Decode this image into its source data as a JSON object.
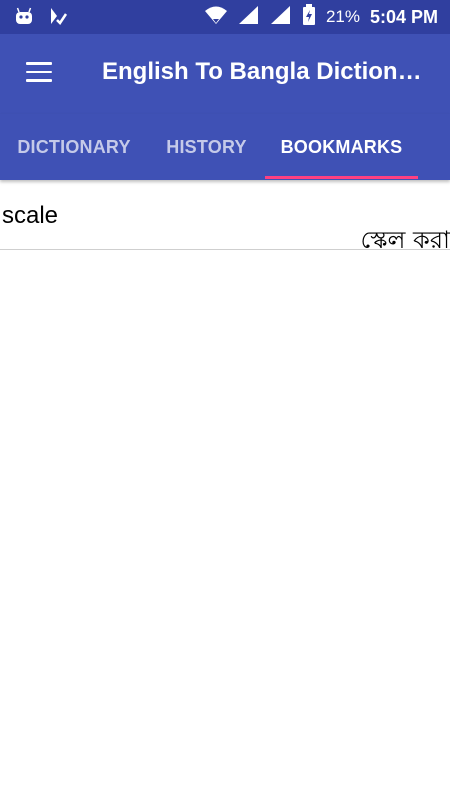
{
  "status_bar": {
    "left_icons": [
      "android-icon",
      "notification-check-icon"
    ],
    "battery": "21%",
    "time": "5:04 PM"
  },
  "toolbar": {
    "menu_icon": "hamburger-menu-icon",
    "title": "English To Bangla Dictionary"
  },
  "tabs": [
    {
      "label": "DICTIONARY",
      "active": false
    },
    {
      "label": "HISTORY",
      "active": false
    },
    {
      "label": "BOOKMARKS",
      "active": true
    }
  ],
  "bookmarks": [
    {
      "word": "scale",
      "meaning": "স্কেল করা"
    }
  ],
  "colors": {
    "status_bar": "#303f9f",
    "primary": "#3f51b5",
    "tab_indicator": "#ff4081"
  }
}
